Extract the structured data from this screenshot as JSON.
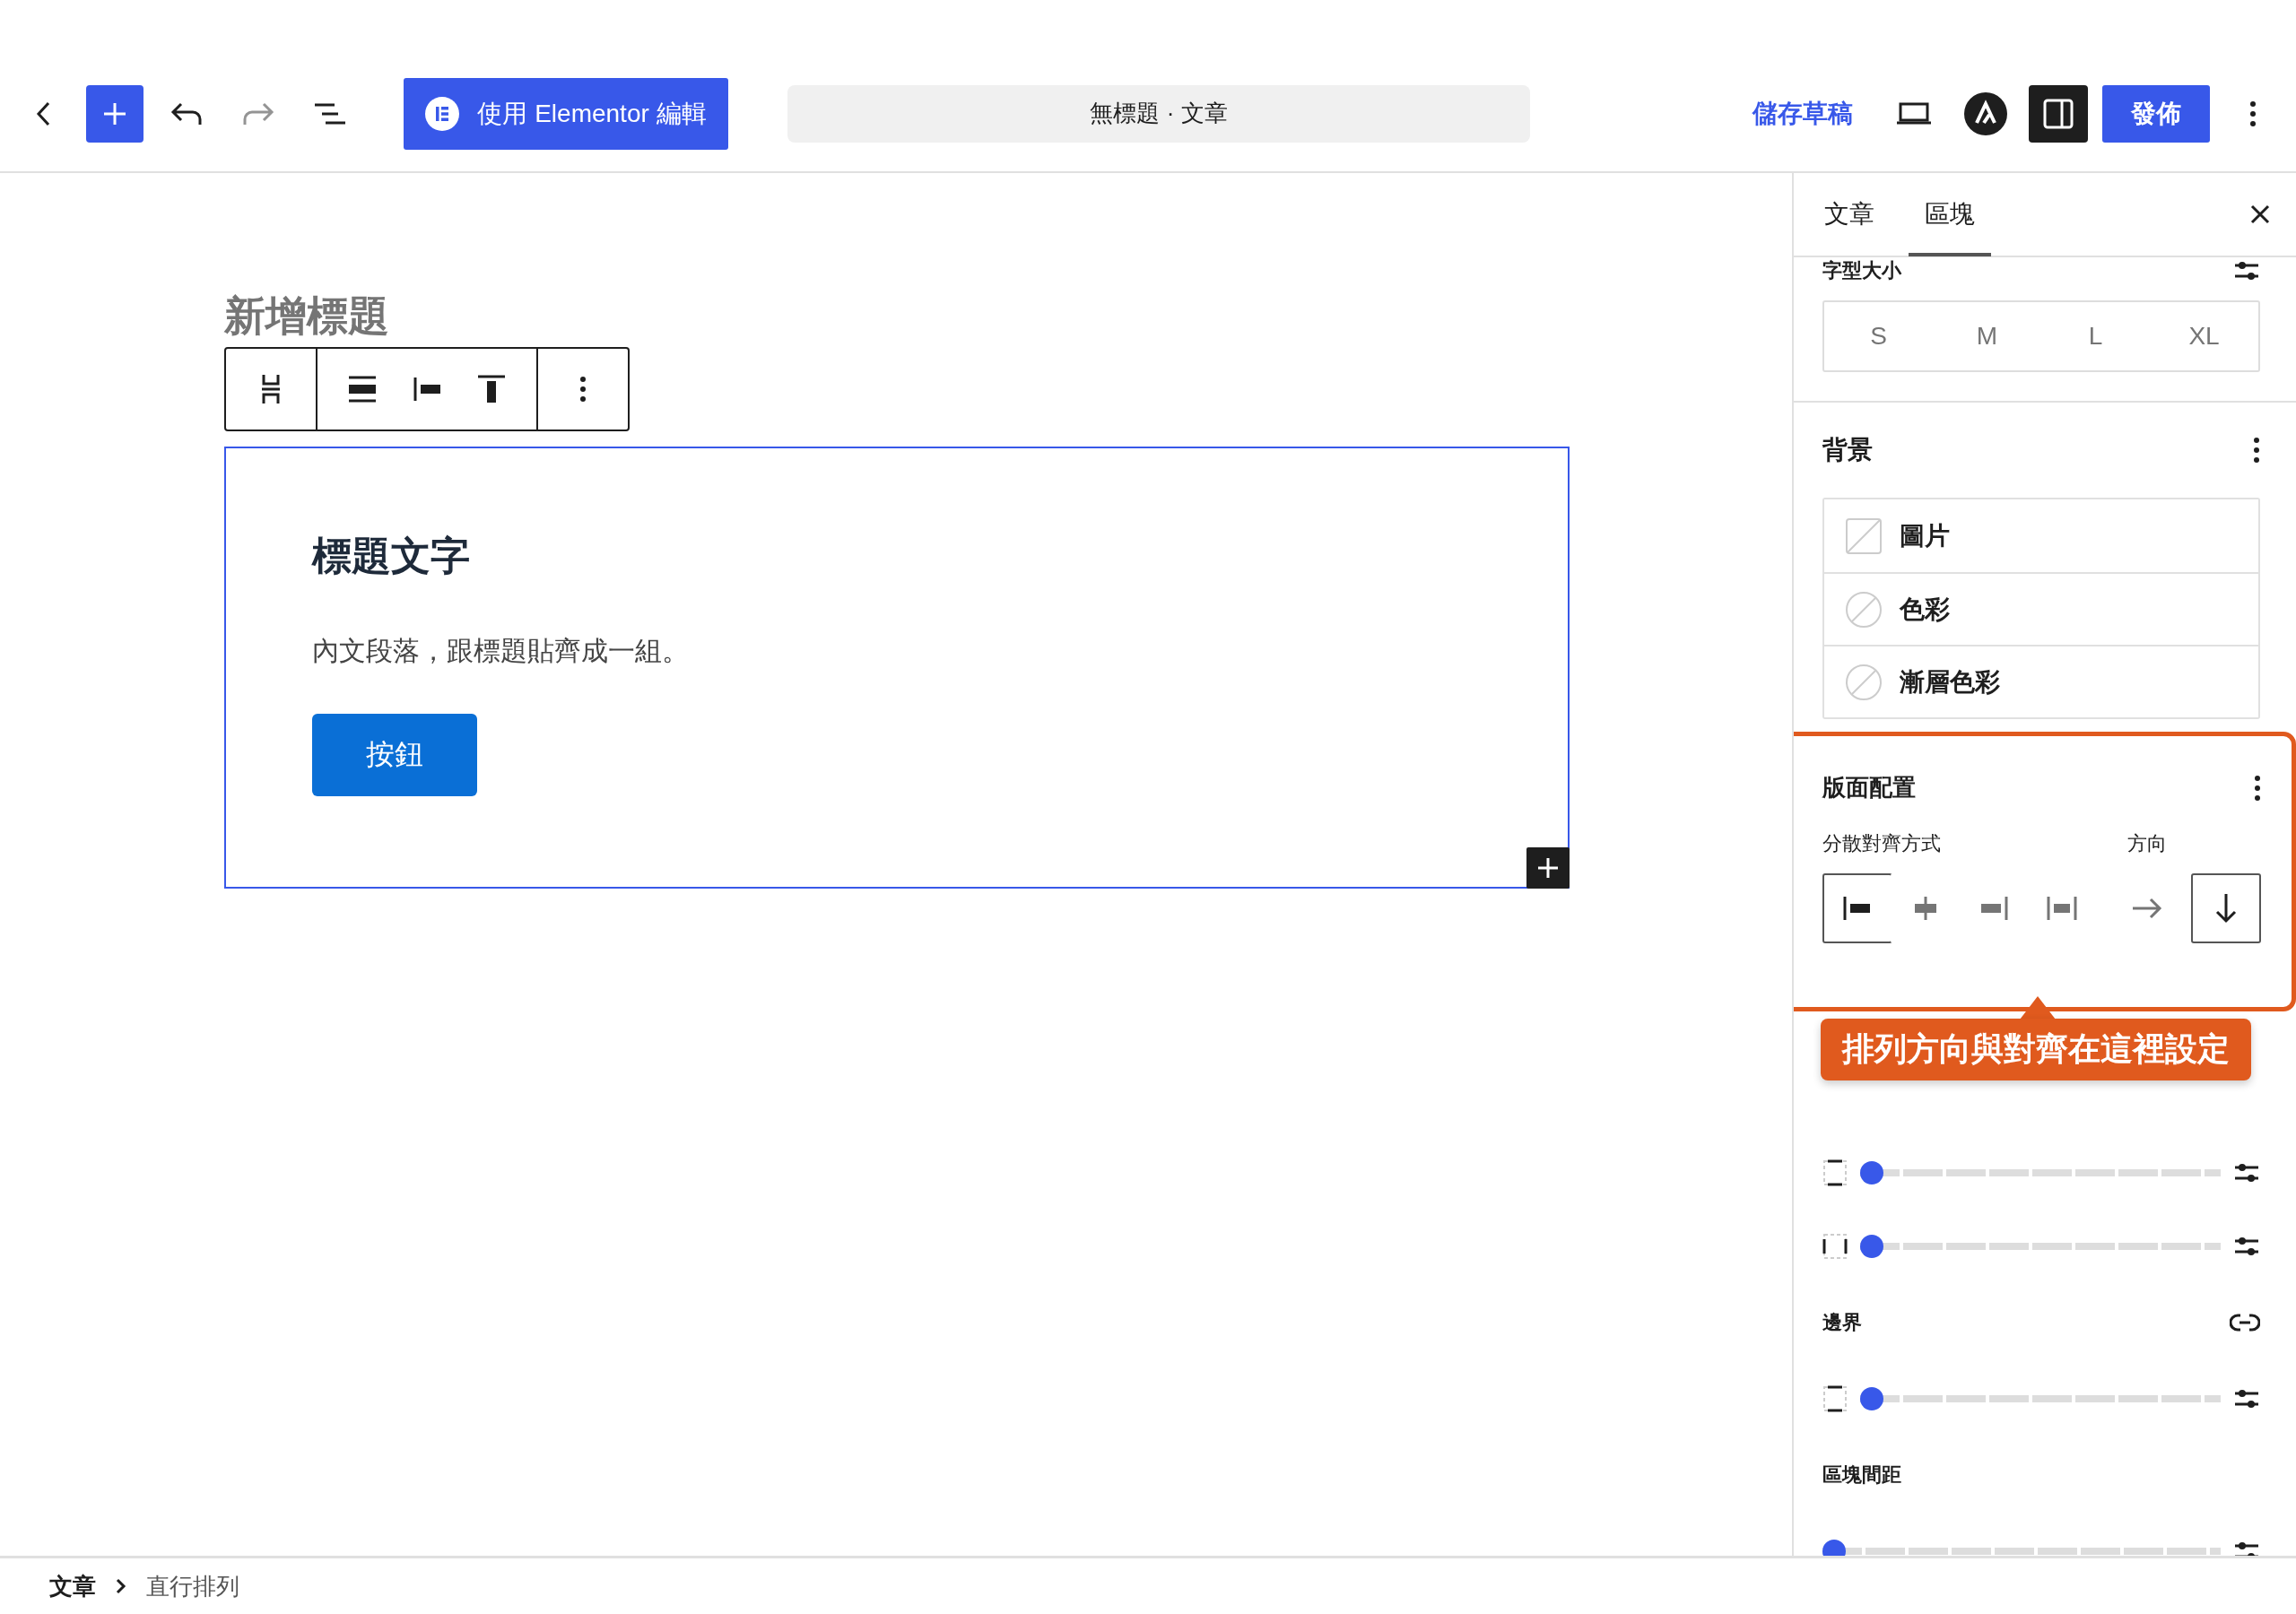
{
  "header": {
    "undo": {
      "disabled": false
    },
    "redo": {
      "disabled": true
    },
    "elementor_button": "使用 Elementor 編輯",
    "document_title": "無標題 · 文章",
    "save_draft": "儲存草稿",
    "sidebar_toggle": {
      "pressed": true
    },
    "publish": "發佈"
  },
  "canvas": {
    "post_title": "新增標題",
    "group": {
      "heading": "標題文字",
      "paragraph": "內文段落，跟標題貼齊成一組。",
      "button": "按鈕"
    }
  },
  "sidebar": {
    "tabs": [
      {
        "label": "文章",
        "selected": false
      },
      {
        "label": "區塊",
        "selected": true
      }
    ],
    "typography": {
      "label": "字型大小",
      "sizes": [
        {
          "label": "S",
          "selected": false
        },
        {
          "label": "M",
          "selected": false
        },
        {
          "label": "L",
          "selected": false
        },
        {
          "label": "XL",
          "selected": false
        }
      ]
    },
    "background": {
      "title": "背景",
      "items": [
        {
          "kind": "image",
          "label": "圖片"
        },
        {
          "kind": "color",
          "label": "色彩"
        },
        {
          "kind": "gradient",
          "label": "漸層色彩"
        }
      ]
    },
    "layout": {
      "title": "版面配置",
      "justify_label": "分散對齊方式",
      "justify_options": [
        {
          "kind": "left",
          "selected": true
        },
        {
          "kind": "center",
          "selected": false
        },
        {
          "kind": "right",
          "selected": false
        },
        {
          "kind": "space-between",
          "selected": false
        }
      ],
      "orientation_label": "方向",
      "orientation_options": [
        {
          "kind": "horizontal",
          "selected": false
        },
        {
          "kind": "vertical",
          "selected": true
        }
      ]
    },
    "dimensions": {
      "padding_sliders": [
        {
          "kind": "vertical",
          "level": 0
        },
        {
          "kind": "horizontal",
          "level": 0
        }
      ],
      "margin": {
        "label": "邊界",
        "slider": {
          "kind": "vertical",
          "level": 0
        }
      },
      "block_spacing": {
        "label": "區塊間距",
        "slider": {
          "kind": "none",
          "level": 0
        }
      }
    }
  },
  "annotation": {
    "text": "排列方向與對齊在這裡設定"
  },
  "breadcrumb": [
    {
      "label": "文章"
    },
    {
      "label": "直行排列"
    }
  ]
}
